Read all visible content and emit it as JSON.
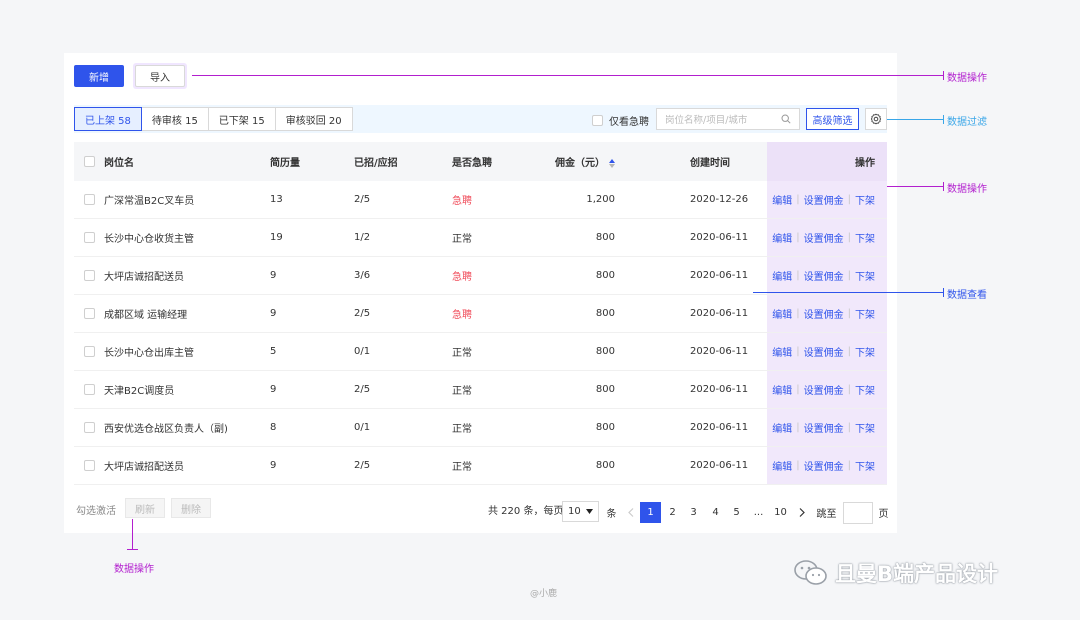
{
  "toolbar": {
    "add_label": "新增",
    "import_label": "导入"
  },
  "tabs": [
    {
      "label": "已上架 58",
      "active": true
    },
    {
      "label": "待审核 15",
      "active": false
    },
    {
      "label": "已下架 15",
      "active": false
    },
    {
      "label": "审核驳回 20",
      "active": false
    }
  ],
  "filters": {
    "urgent_only_label": "仅看急聘",
    "search_placeholder": "岗位名称/项目/城市",
    "advanced_label": "高级筛选"
  },
  "table": {
    "headers": {
      "name": "岗位名",
      "resumes": "简历量",
      "hired": "已招/应招",
      "urgent": "是否急聘",
      "commission": "佣金（元）",
      "created": "创建时间",
      "actions": "操作"
    },
    "rows": [
      {
        "name": "广深常温B2C叉车员",
        "resumes": "13",
        "hired": "2/5",
        "urgent": "急聘",
        "is_urgent": true,
        "commission": "1,200",
        "created": "2020-12-26"
      },
      {
        "name": "长沙中心仓收货主管",
        "resumes": "19",
        "hired": "1/2",
        "urgent": "正常",
        "is_urgent": false,
        "commission": "800",
        "created": "2020-06-11"
      },
      {
        "name": "大坪店诚招配送员",
        "resumes": "9",
        "hired": "3/6",
        "urgent": "急聘",
        "is_urgent": true,
        "commission": "800",
        "created": "2020-06-11"
      },
      {
        "name": "成都区域 运输经理",
        "resumes": "9",
        "hired": "2/5",
        "urgent": "急聘",
        "is_urgent": true,
        "commission": "800",
        "created": "2020-06-11"
      },
      {
        "name": "长沙中心仓出库主管",
        "resumes": "5",
        "hired": "0/1",
        "urgent": "正常",
        "is_urgent": false,
        "commission": "800",
        "created": "2020-06-11"
      },
      {
        "name": "天津B2C调度员",
        "resumes": "9",
        "hired": "2/5",
        "urgent": "正常",
        "is_urgent": false,
        "commission": "800",
        "created": "2020-06-11"
      },
      {
        "name": "西安优选仓战区负责人（副)",
        "resumes": "8",
        "hired": "0/1",
        "urgent": "正常",
        "is_urgent": false,
        "commission": "800",
        "created": "2020-06-11"
      },
      {
        "name": "大坪店诚招配送员",
        "resumes": "9",
        "hired": "2/5",
        "urgent": "正常",
        "is_urgent": false,
        "commission": "800",
        "created": "2020-06-11"
      }
    ],
    "row_actions": {
      "edit": "编辑",
      "set_commission": "设置佣金",
      "delist": "下架"
    }
  },
  "footer": {
    "select_activate_label": "勾选激活",
    "refresh_label": "刷新",
    "delete_label": "删除",
    "total_text": "共 220 条，每页",
    "page_size": "10",
    "unit": "条",
    "pages": [
      "1",
      "2",
      "3",
      "4",
      "5",
      "...",
      "10"
    ],
    "current_page": "1",
    "jump_label": "跳至",
    "page_suffix": "页"
  },
  "annotations": {
    "data_ops_1": "数据操作",
    "data_filter": "数据过滤",
    "data_ops_2": "数据操作",
    "data_view": "数据查看",
    "data_ops_3": "数据操作"
  },
  "watermark": {
    "text": "且曼B端产品设计",
    "credit": "@小鹿"
  },
  "colors": {
    "primary": "#2f54eb",
    "urgent": "#f04d5b",
    "annotation_magenta": "#b21fce",
    "annotation_sky": "#39a6e8"
  }
}
